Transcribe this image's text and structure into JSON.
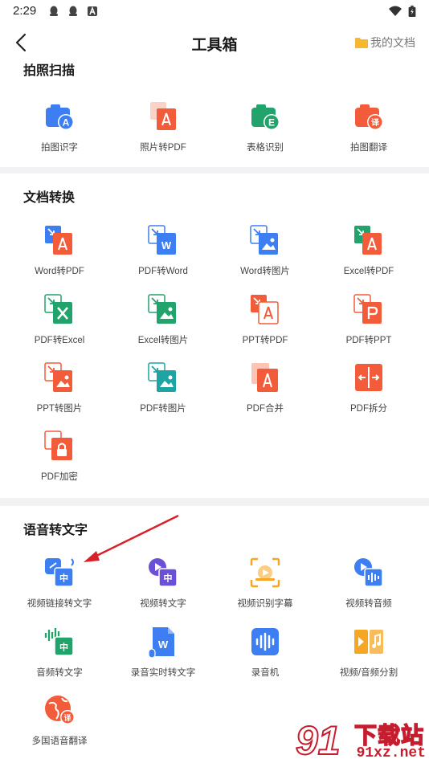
{
  "status_bar": {
    "time": "2:29"
  },
  "header": {
    "title": "工具箱",
    "my_docs": "我的文档"
  },
  "sections": [
    {
      "title": "拍照扫描",
      "tools": [
        {
          "label": "拍图识字",
          "icon": "camera-text-icon"
        },
        {
          "label": "照片转PDF",
          "icon": "photo-to-pdf-icon"
        },
        {
          "label": "表格识别",
          "icon": "table-recognize-icon"
        },
        {
          "label": "拍图翻译",
          "icon": "camera-translate-icon"
        }
      ]
    },
    {
      "title": "文档转换",
      "tools": [
        {
          "label": "Word转PDF",
          "icon": "word-to-pdf-icon"
        },
        {
          "label": "PDF转Word",
          "icon": "pdf-to-word-icon"
        },
        {
          "label": "Word转图片",
          "icon": "word-to-image-icon"
        },
        {
          "label": "Excel转PDF",
          "icon": "excel-to-pdf-icon"
        },
        {
          "label": "PDF转Excel",
          "icon": "pdf-to-excel-icon"
        },
        {
          "label": "Excel转图片",
          "icon": "excel-to-image-icon"
        },
        {
          "label": "PPT转PDF",
          "icon": "ppt-to-pdf-icon"
        },
        {
          "label": "PDF转PPT",
          "icon": "pdf-to-ppt-icon"
        },
        {
          "label": "PPT转图片",
          "icon": "ppt-to-image-icon"
        },
        {
          "label": "PDF转图片",
          "icon": "pdf-to-image-icon"
        },
        {
          "label": "PDF合并",
          "icon": "pdf-merge-icon"
        },
        {
          "label": "PDF拆分",
          "icon": "pdf-split-icon"
        },
        {
          "label": "PDF加密",
          "icon": "pdf-encrypt-icon"
        }
      ]
    },
    {
      "title": "语音转文字",
      "tools": [
        {
          "label": "视频链接转文字",
          "icon": "video-link-text-icon"
        },
        {
          "label": "视频转文字",
          "icon": "video-text-icon"
        },
        {
          "label": "视频识别字幕",
          "icon": "video-subtitle-icon"
        },
        {
          "label": "视频转音频",
          "icon": "video-audio-icon"
        },
        {
          "label": "音频转文字",
          "icon": "audio-text-icon"
        },
        {
          "label": "录音实时转文字",
          "icon": "realtime-record-text-icon"
        },
        {
          "label": "录音机",
          "icon": "recorder-icon"
        },
        {
          "label": "视频/音频分割",
          "icon": "media-split-icon"
        },
        {
          "label": "多国语音翻译",
          "icon": "voice-translate-icon"
        }
      ]
    }
  ],
  "watermark": {
    "brand": "下载站",
    "url": "91xz.net",
    "logo": "91"
  },
  "colors": {
    "red": "#f25c3a",
    "blue": "#3d7ff2",
    "green": "#22a36b",
    "orange": "#f5a623",
    "purple": "#6b4fd6",
    "teal": "#1fa3a3"
  }
}
